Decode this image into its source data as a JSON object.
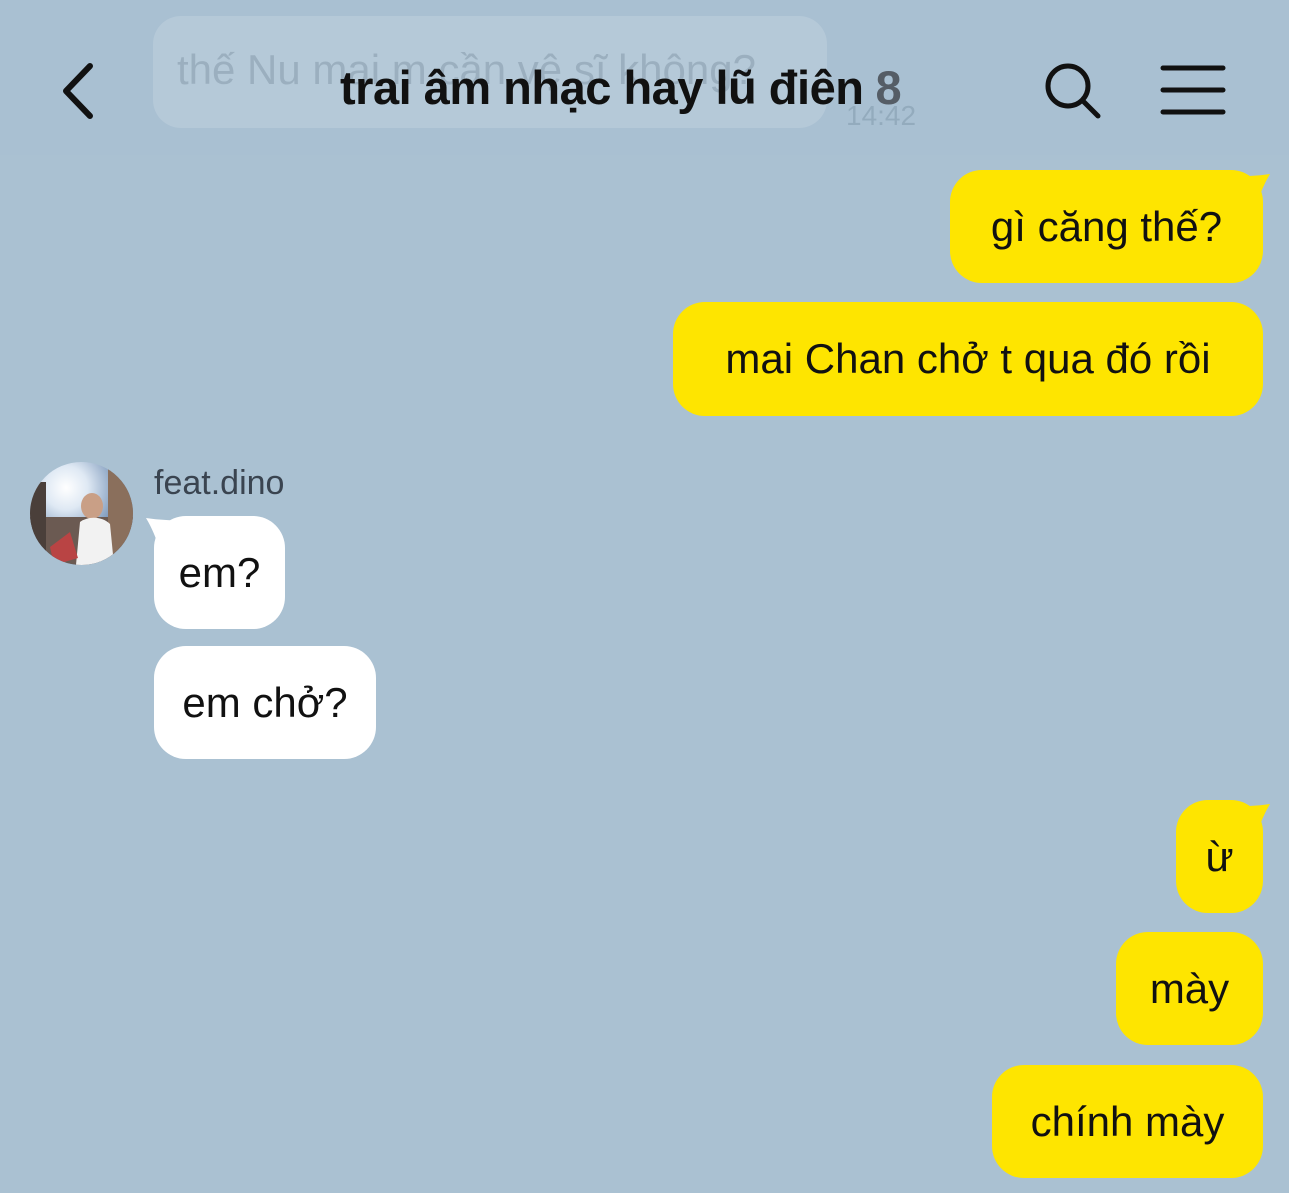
{
  "header": {
    "title": "trai âm nhạc hay lũ điên",
    "member_count": "8",
    "background_preview_text": "thế Nu mai m cần vệ sĩ không?",
    "background_preview_time": "14:42",
    "icons": {
      "back": "chevron-left-icon",
      "search": "search-icon",
      "menu": "hamburger-menu-icon"
    }
  },
  "colors": {
    "background": "#aac1d2",
    "my_bubble": "#fee500",
    "their_bubble": "#ffffff",
    "text": "#111111"
  },
  "messages": [
    {
      "from": "me",
      "text": "gì căng thế?"
    },
    {
      "from": "me",
      "text": "mai Chan chở t qua đó rồi"
    },
    {
      "from": "feat.dino",
      "text": "em?"
    },
    {
      "from": "feat.dino",
      "text": "em chở?"
    },
    {
      "from": "me",
      "text": "ừ"
    },
    {
      "from": "me",
      "text": "mày"
    },
    {
      "from": "me",
      "text": "chính mày"
    }
  ],
  "sender": {
    "name": "feat.dino"
  }
}
